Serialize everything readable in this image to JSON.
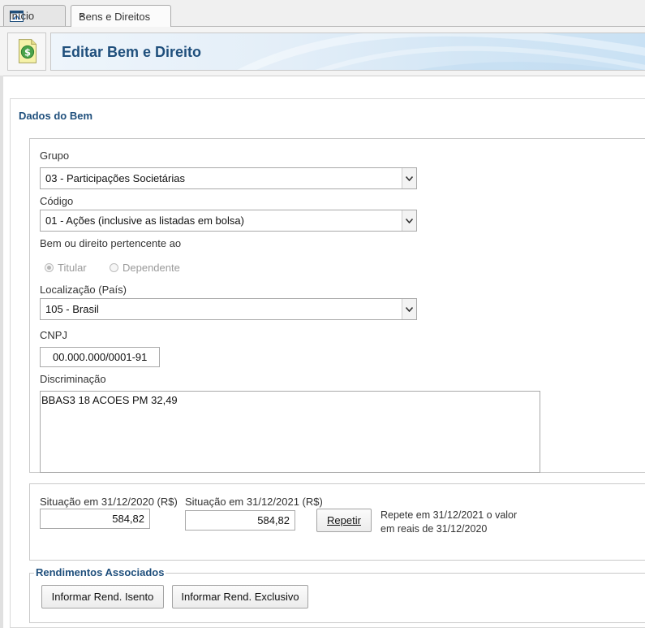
{
  "tabs": [
    {
      "label": "Início",
      "icon": "home-icon"
    },
    {
      "label": "Bens e Direitos",
      "close": "×"
    }
  ],
  "header": {
    "title": "Editar Bem e Direito",
    "icon": "money-document-icon"
  },
  "section": {
    "title": "Dados do Bem"
  },
  "form": {
    "grupo": {
      "label": "Grupo",
      "value": "03 - Participações Societárias"
    },
    "codigo": {
      "label": "Código",
      "value": "01 - Ações (inclusive as listadas em bolsa)"
    },
    "pertencente": {
      "label": "Bem ou direito pertencente ao",
      "options": [
        {
          "label": "Titular",
          "checked": true
        },
        {
          "label": "Dependente",
          "checked": false
        }
      ]
    },
    "localizacao": {
      "label": "Localização (País)",
      "value": "105 - Brasil"
    },
    "cnpj": {
      "label": "CNPJ",
      "value": "00.000.000/0001-91"
    },
    "discriminacao": {
      "label": "Discriminação",
      "value": "BBAS3 18 ACOES PM 32,49"
    }
  },
  "situacao": {
    "y2020": {
      "label": "Situação em 31/12/2020 (R$)",
      "value": "584,82"
    },
    "y2021": {
      "label": "Situação em 31/12/2021 (R$)",
      "value": "584,82"
    },
    "repetir_button": "Repetir",
    "repetir_note_line1": "Repete em 31/12/2021 o valor",
    "repetir_note_line2": "em reais de 31/12/2020"
  },
  "rendimentos": {
    "title": "Rendimentos Associados",
    "isento_button": "Informar Rend. Isento",
    "exclusivo_button": "Informar Rend. Exclusivo"
  },
  "colors": {
    "accent": "#1f4f7c"
  }
}
